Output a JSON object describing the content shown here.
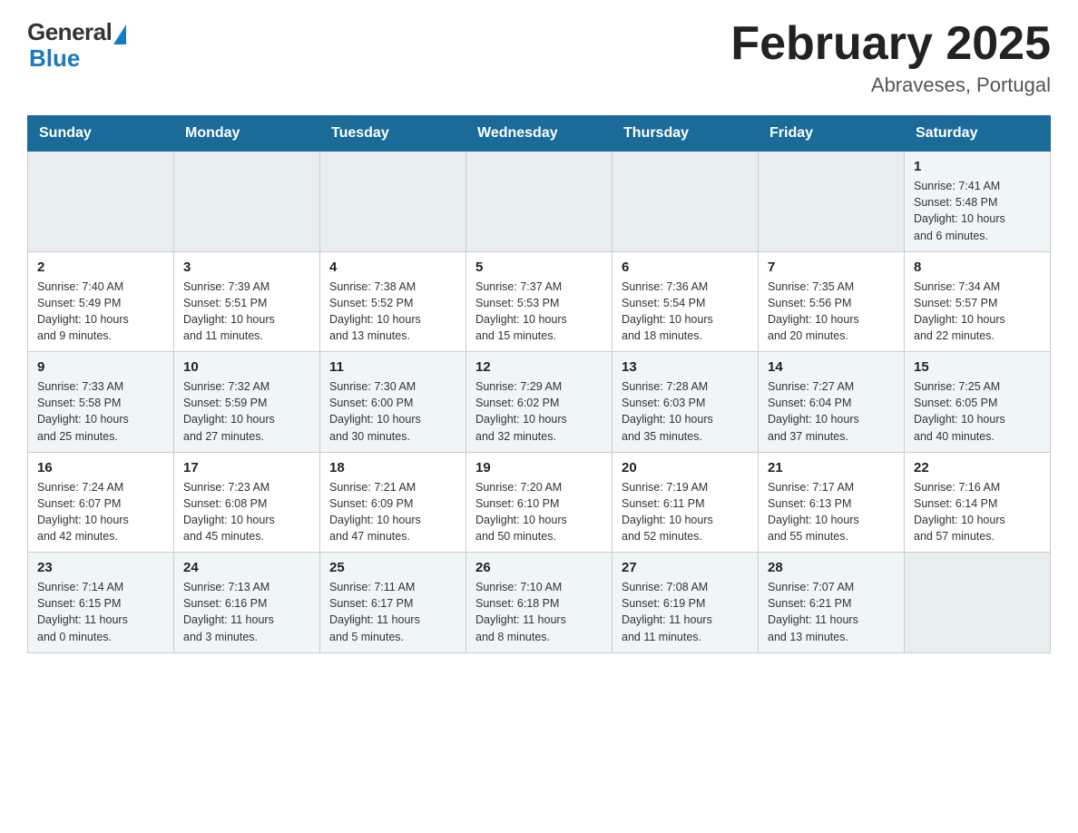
{
  "header": {
    "logo": {
      "general": "General",
      "blue": "Blue"
    },
    "title": "February 2025",
    "subtitle": "Abraveses, Portugal"
  },
  "calendar": {
    "weekdays": [
      "Sunday",
      "Monday",
      "Tuesday",
      "Wednesday",
      "Thursday",
      "Friday",
      "Saturday"
    ],
    "weeks": [
      [
        {
          "day": "",
          "info": ""
        },
        {
          "day": "",
          "info": ""
        },
        {
          "day": "",
          "info": ""
        },
        {
          "day": "",
          "info": ""
        },
        {
          "day": "",
          "info": ""
        },
        {
          "day": "",
          "info": ""
        },
        {
          "day": "1",
          "info": "Sunrise: 7:41 AM\nSunset: 5:48 PM\nDaylight: 10 hours\nand 6 minutes."
        }
      ],
      [
        {
          "day": "2",
          "info": "Sunrise: 7:40 AM\nSunset: 5:49 PM\nDaylight: 10 hours\nand 9 minutes."
        },
        {
          "day": "3",
          "info": "Sunrise: 7:39 AM\nSunset: 5:51 PM\nDaylight: 10 hours\nand 11 minutes."
        },
        {
          "day": "4",
          "info": "Sunrise: 7:38 AM\nSunset: 5:52 PM\nDaylight: 10 hours\nand 13 minutes."
        },
        {
          "day": "5",
          "info": "Sunrise: 7:37 AM\nSunset: 5:53 PM\nDaylight: 10 hours\nand 15 minutes."
        },
        {
          "day": "6",
          "info": "Sunrise: 7:36 AM\nSunset: 5:54 PM\nDaylight: 10 hours\nand 18 minutes."
        },
        {
          "day": "7",
          "info": "Sunrise: 7:35 AM\nSunset: 5:56 PM\nDaylight: 10 hours\nand 20 minutes."
        },
        {
          "day": "8",
          "info": "Sunrise: 7:34 AM\nSunset: 5:57 PM\nDaylight: 10 hours\nand 22 minutes."
        }
      ],
      [
        {
          "day": "9",
          "info": "Sunrise: 7:33 AM\nSunset: 5:58 PM\nDaylight: 10 hours\nand 25 minutes."
        },
        {
          "day": "10",
          "info": "Sunrise: 7:32 AM\nSunset: 5:59 PM\nDaylight: 10 hours\nand 27 minutes."
        },
        {
          "day": "11",
          "info": "Sunrise: 7:30 AM\nSunset: 6:00 PM\nDaylight: 10 hours\nand 30 minutes."
        },
        {
          "day": "12",
          "info": "Sunrise: 7:29 AM\nSunset: 6:02 PM\nDaylight: 10 hours\nand 32 minutes."
        },
        {
          "day": "13",
          "info": "Sunrise: 7:28 AM\nSunset: 6:03 PM\nDaylight: 10 hours\nand 35 minutes."
        },
        {
          "day": "14",
          "info": "Sunrise: 7:27 AM\nSunset: 6:04 PM\nDaylight: 10 hours\nand 37 minutes."
        },
        {
          "day": "15",
          "info": "Sunrise: 7:25 AM\nSunset: 6:05 PM\nDaylight: 10 hours\nand 40 minutes."
        }
      ],
      [
        {
          "day": "16",
          "info": "Sunrise: 7:24 AM\nSunset: 6:07 PM\nDaylight: 10 hours\nand 42 minutes."
        },
        {
          "day": "17",
          "info": "Sunrise: 7:23 AM\nSunset: 6:08 PM\nDaylight: 10 hours\nand 45 minutes."
        },
        {
          "day": "18",
          "info": "Sunrise: 7:21 AM\nSunset: 6:09 PM\nDaylight: 10 hours\nand 47 minutes."
        },
        {
          "day": "19",
          "info": "Sunrise: 7:20 AM\nSunset: 6:10 PM\nDaylight: 10 hours\nand 50 minutes."
        },
        {
          "day": "20",
          "info": "Sunrise: 7:19 AM\nSunset: 6:11 PM\nDaylight: 10 hours\nand 52 minutes."
        },
        {
          "day": "21",
          "info": "Sunrise: 7:17 AM\nSunset: 6:13 PM\nDaylight: 10 hours\nand 55 minutes."
        },
        {
          "day": "22",
          "info": "Sunrise: 7:16 AM\nSunset: 6:14 PM\nDaylight: 10 hours\nand 57 minutes."
        }
      ],
      [
        {
          "day": "23",
          "info": "Sunrise: 7:14 AM\nSunset: 6:15 PM\nDaylight: 11 hours\nand 0 minutes."
        },
        {
          "day": "24",
          "info": "Sunrise: 7:13 AM\nSunset: 6:16 PM\nDaylight: 11 hours\nand 3 minutes."
        },
        {
          "day": "25",
          "info": "Sunrise: 7:11 AM\nSunset: 6:17 PM\nDaylight: 11 hours\nand 5 minutes."
        },
        {
          "day": "26",
          "info": "Sunrise: 7:10 AM\nSunset: 6:18 PM\nDaylight: 11 hours\nand 8 minutes."
        },
        {
          "day": "27",
          "info": "Sunrise: 7:08 AM\nSunset: 6:19 PM\nDaylight: 11 hours\nand 11 minutes."
        },
        {
          "day": "28",
          "info": "Sunrise: 7:07 AM\nSunset: 6:21 PM\nDaylight: 11 hours\nand 13 minutes."
        },
        {
          "day": "",
          "info": ""
        }
      ]
    ]
  }
}
